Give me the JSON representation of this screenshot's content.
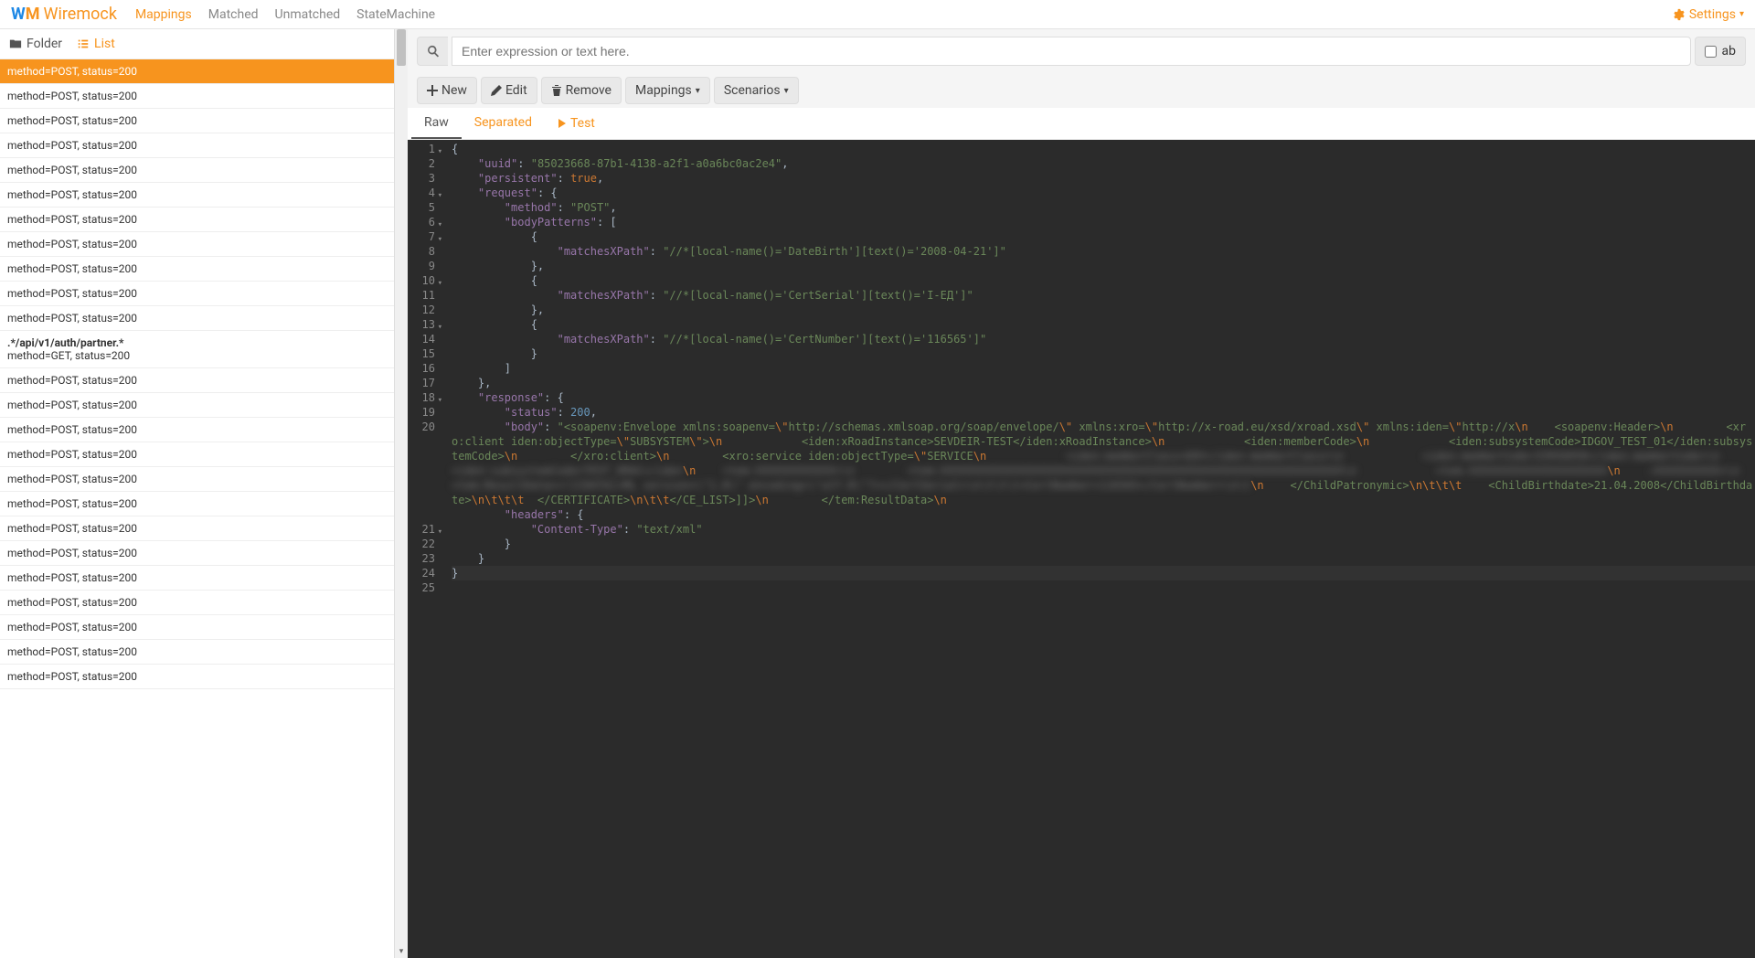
{
  "header": {
    "logo_text": "Wiremock",
    "nav": [
      "Mappings",
      "Matched",
      "Unmatched",
      "StateMachine"
    ],
    "active_nav": 0,
    "settings_label": "Settings"
  },
  "sidebar": {
    "tabs": {
      "folder": "Folder",
      "list": "List"
    },
    "items": [
      {
        "sub": "method=POST, status=200",
        "selected": true
      },
      {
        "sub": "method=POST, status=200"
      },
      {
        "sub": "method=POST, status=200"
      },
      {
        "sub": "method=POST, status=200"
      },
      {
        "sub": "method=POST, status=200"
      },
      {
        "sub": "method=POST, status=200"
      },
      {
        "sub": "method=POST, status=200"
      },
      {
        "sub": "method=POST, status=200"
      },
      {
        "sub": "method=POST, status=200"
      },
      {
        "sub": "method=POST, status=200"
      },
      {
        "sub": "method=POST, status=200"
      },
      {
        "title": ".*/api/v1/auth/partner.*",
        "sub": "method=GET, status=200"
      },
      {
        "sub": "method=POST, status=200"
      },
      {
        "sub": "method=POST, status=200"
      },
      {
        "sub": "method=POST, status=200"
      },
      {
        "sub": "method=POST, status=200"
      },
      {
        "sub": "method=POST, status=200"
      },
      {
        "sub": "method=POST, status=200"
      },
      {
        "sub": "method=POST, status=200"
      },
      {
        "sub": "method=POST, status=200"
      },
      {
        "sub": "method=POST, status=200"
      },
      {
        "sub": "method=POST, status=200"
      },
      {
        "sub": "method=POST, status=200"
      },
      {
        "sub": "method=POST, status=200"
      },
      {
        "sub": "method=POST, status=200"
      }
    ]
  },
  "search": {
    "placeholder": "Enter expression or text here.",
    "checkbox_label": "ab"
  },
  "toolbar": {
    "new": "New",
    "edit": "Edit",
    "remove": "Remove",
    "mappings": "Mappings",
    "scenarios": "Scenarios"
  },
  "content_tabs": {
    "raw": "Raw",
    "separated": "Separated",
    "test": "Test"
  },
  "editor": {
    "lines": [
      {
        "n": 1,
        "fold": true,
        "tokens": [
          [
            "punct",
            "{"
          ]
        ]
      },
      {
        "n": 2,
        "tokens": [
          [
            "indent",
            "    "
          ],
          [
            "key",
            "\"uuid\""
          ],
          [
            "punct",
            ": "
          ],
          [
            "str",
            "\"85023668-87b1-4138-a2f1-a0a6bc0ac2e4\""
          ],
          [
            "punct",
            ","
          ]
        ]
      },
      {
        "n": 3,
        "tokens": [
          [
            "indent",
            "    "
          ],
          [
            "key",
            "\"persistent\""
          ],
          [
            "punct",
            ": "
          ],
          [
            "bool",
            "true"
          ],
          [
            "punct",
            ","
          ]
        ]
      },
      {
        "n": 4,
        "fold": true,
        "tokens": [
          [
            "indent",
            "    "
          ],
          [
            "key",
            "\"request\""
          ],
          [
            "punct",
            ": {"
          ]
        ]
      },
      {
        "n": 5,
        "tokens": [
          [
            "indent",
            "        "
          ],
          [
            "key",
            "\"method\""
          ],
          [
            "punct",
            ": "
          ],
          [
            "str",
            "\"POST\""
          ],
          [
            "punct",
            ","
          ]
        ]
      },
      {
        "n": 6,
        "fold": true,
        "tokens": [
          [
            "indent",
            "        "
          ],
          [
            "key",
            "\"bodyPatterns\""
          ],
          [
            "punct",
            ": ["
          ]
        ]
      },
      {
        "n": 7,
        "fold": true,
        "tokens": [
          [
            "indent",
            "            "
          ],
          [
            "punct",
            "{"
          ]
        ]
      },
      {
        "n": 8,
        "tokens": [
          [
            "indent",
            "                "
          ],
          [
            "key",
            "\"matchesXPath\""
          ],
          [
            "punct",
            ": "
          ],
          [
            "str",
            "\"//*[local-name()='DateBirth'][text()='2008-04-21']\""
          ]
        ]
      },
      {
        "n": 9,
        "tokens": [
          [
            "indent",
            "            "
          ],
          [
            "punct",
            "},"
          ]
        ]
      },
      {
        "n": 10,
        "fold": true,
        "tokens": [
          [
            "indent",
            "            "
          ],
          [
            "punct",
            "{"
          ]
        ]
      },
      {
        "n": 11,
        "tokens": [
          [
            "indent",
            "                "
          ],
          [
            "key",
            "\"matchesXPath\""
          ],
          [
            "punct",
            ": "
          ],
          [
            "str",
            "\"//*[local-name()='CertSerial'][text()='І-ЕД']\""
          ]
        ]
      },
      {
        "n": 12,
        "tokens": [
          [
            "indent",
            "            "
          ],
          [
            "punct",
            "},"
          ]
        ]
      },
      {
        "n": 13,
        "fold": true,
        "tokens": [
          [
            "indent",
            "            "
          ],
          [
            "punct",
            "{"
          ]
        ]
      },
      {
        "n": 14,
        "tokens": [
          [
            "indent",
            "                "
          ],
          [
            "key",
            "\"matchesXPath\""
          ],
          [
            "punct",
            ": "
          ],
          [
            "str",
            "\"//*[local-name()='CertNumber'][text()='116565']\""
          ]
        ]
      },
      {
        "n": 15,
        "tokens": [
          [
            "indent",
            "            "
          ],
          [
            "punct",
            "}"
          ]
        ]
      },
      {
        "n": 16,
        "tokens": [
          [
            "indent",
            "        "
          ],
          [
            "punct",
            "]"
          ]
        ]
      },
      {
        "n": 17,
        "tokens": [
          [
            "indent",
            "    "
          ],
          [
            "punct",
            "},"
          ]
        ]
      },
      {
        "n": 18,
        "fold": true,
        "tokens": [
          [
            "indent",
            "    "
          ],
          [
            "key",
            "\"response\""
          ],
          [
            "punct",
            ": {"
          ]
        ]
      },
      {
        "n": 19,
        "tokens": [
          [
            "indent",
            "        "
          ],
          [
            "key",
            "\"status\""
          ],
          [
            "punct",
            ": "
          ],
          [
            "num",
            "200"
          ],
          [
            "punct",
            ","
          ]
        ]
      },
      {
        "n": 20,
        "multi": true,
        "tokens": [
          [
            "indent",
            "        "
          ],
          [
            "key",
            "\"body\""
          ],
          [
            "punct",
            ": "
          ],
          [
            "str",
            "\"<soapenv:Envelope xmlns:soapenv="
          ],
          [
            "esc",
            "\\\""
          ],
          [
            "str",
            "http://schemas.xmlsoap.org/soap/envelope/"
          ],
          [
            "esc",
            "\\\""
          ],
          [
            "str",
            " xmlns:xro="
          ],
          [
            "esc",
            "\\\""
          ],
          [
            "str",
            "http://x-road.eu/xsd/xroad.xsd"
          ],
          [
            "esc",
            "\\\""
          ],
          [
            "str",
            " xmlns:iden="
          ],
          [
            "esc",
            "\\\""
          ],
          [
            "str",
            "http://x"
          ],
          [
            "esc",
            "\\n"
          ],
          [
            "str",
            "    <soapenv:Header>"
          ],
          [
            "esc",
            "\\n"
          ],
          [
            "str",
            "        <xro:client iden:objectType="
          ],
          [
            "esc",
            "\\\""
          ],
          [
            "str",
            "SUBSYSTEM"
          ],
          [
            "esc",
            "\\\""
          ],
          [
            "str",
            ">"
          ],
          [
            "esc",
            "\\n"
          ],
          [
            "str",
            "            <iden:xRoadInstance>SEVDEIR-TEST</iden:xRoadInstance>"
          ],
          [
            "esc",
            "\\n"
          ],
          [
            "str",
            "            <iden:memberCode>"
          ],
          [
            "esc",
            "\\n"
          ],
          [
            "str",
            "            <iden:subsystemCode>IDGOV_TEST_01</iden:subsystemCode>"
          ],
          [
            "esc",
            "\\n"
          ],
          [
            "str",
            "        </xro:client>"
          ],
          [
            "esc",
            "\\n"
          ],
          [
            "str",
            "        <xro:service iden:objectType="
          ],
          [
            "esc",
            "\\\""
          ],
          [
            "str",
            "SERVICE"
          ],
          [
            "esc",
            "\\n"
          ],
          [
            "blurred",
            "            <iden:memberClass>GOV</iden:memberClass>\\n            <iden:memberCode>33956058</iden:memberCode>\\n            <iden:subsystemCode>TEST_DRAC</iden"
          ],
          [
            "esc",
            "\\n"
          ],
          [
            "blurred",
            "    <tem:XXXXXXXXXXXX>\\n        <tem:XXXXXXXXXXXXXXXXXXXXXXXXXXXXXXXXXXXXXXXXXXXXXXXXXXXXXXXXXXXXX\\n            <tem:XXXXXXXXXXXXXXXXXXXXX"
          ],
          [
            "esc",
            "\\n"
          ],
          [
            "blurred",
            "    :XXXXXXXXXX>\\n            <tem:ResultData><![CDATA[<ML version=\\\"1.0\\\" encoding=\\\"utf-8\\\"?></CertSerial>\\n\\t\\t\\t<CertNumber>116565</CertNumber>\\n\\t"
          ],
          [
            "esc",
            "\\n"
          ],
          [
            "str",
            "    </ChildPatronymic>"
          ],
          [
            "esc",
            "\\n\\t\\t\\t"
          ],
          [
            "str",
            "    <ChildBirthdate>21.04.2008</ChildBirthdate>"
          ],
          [
            "esc",
            "\\n\\t\\t\\t"
          ],
          [
            "str",
            "  </CERTIFICATE>"
          ],
          [
            "esc",
            "\\n\\t\\t"
          ],
          [
            "str",
            "</CE_LIST>]]>"
          ],
          [
            "esc",
            "\\n"
          ],
          [
            "str",
            "        </tem:ResultData>"
          ],
          [
            "esc",
            "\\n"
          ]
        ]
      },
      {
        "n": 21,
        "fold": true,
        "tokens": [
          [
            "indent",
            "        "
          ],
          [
            "key",
            "\"headers\""
          ],
          [
            "punct",
            ": {"
          ]
        ]
      },
      {
        "n": 22,
        "tokens": [
          [
            "indent",
            "            "
          ],
          [
            "key",
            "\"Content-Type\""
          ],
          [
            "punct",
            ": "
          ],
          [
            "str",
            "\"text/xml\""
          ]
        ]
      },
      {
        "n": 23,
        "tokens": [
          [
            "indent",
            "        "
          ],
          [
            "punct",
            "}"
          ]
        ]
      },
      {
        "n": 24,
        "tokens": [
          [
            "indent",
            "    "
          ],
          [
            "punct",
            "}"
          ]
        ]
      },
      {
        "n": 25,
        "current": true,
        "tokens": [
          [
            "punct",
            "}"
          ]
        ]
      }
    ]
  }
}
